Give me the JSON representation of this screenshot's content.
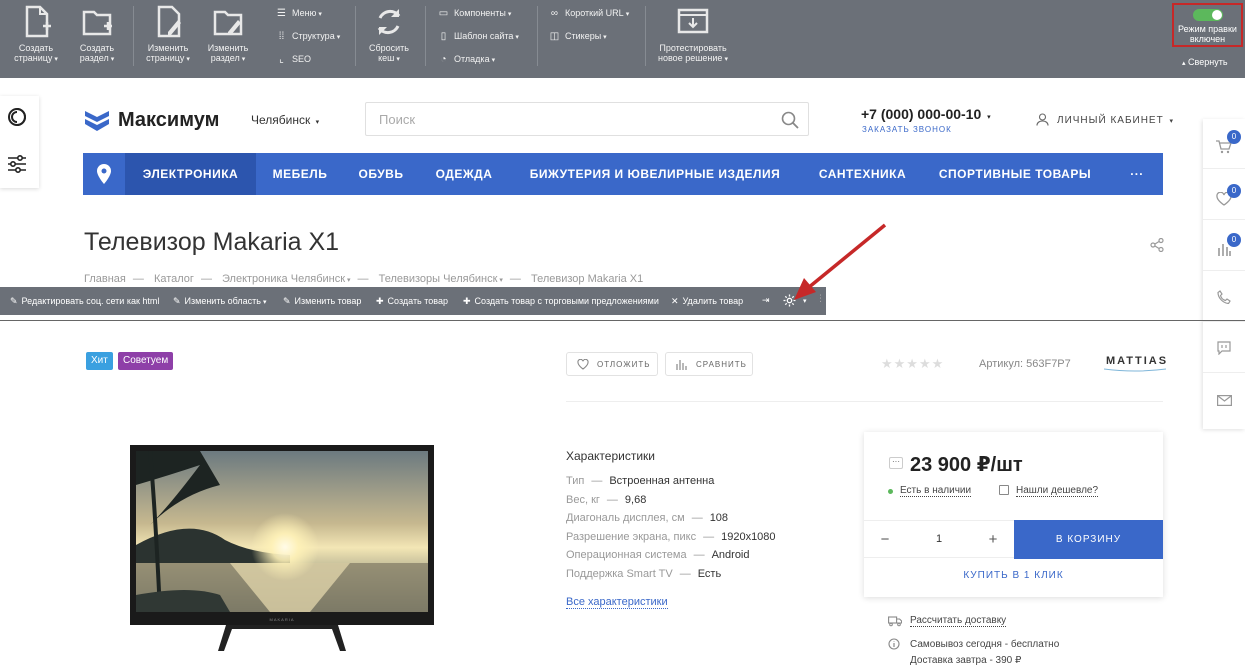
{
  "admin_bar": {
    "create_page": "Создать страницу",
    "create_section": "Создать раздел",
    "edit_page": "Изменить страницу",
    "edit_section": "Изменить раздел",
    "menu": "Меню",
    "structure": "Структура",
    "seo": "SEO",
    "reset_cache": "Сбросить кеш",
    "components": "Компоненты",
    "site_template": "Шаблон сайта",
    "debug": "Отладка",
    "short_url": "Короткий URL",
    "stickers": "Стикеры",
    "test_solution": "Протестировать новое решение",
    "edit_mode": "Режим правки включен",
    "collapse": "Свернуть"
  },
  "header": {
    "logo": "Максимум",
    "city": "Челябинск",
    "search_placeholder": "Поиск",
    "phone": "+7 (000) 000-00-10",
    "callback": "ЗАКАЗАТЬ ЗВОНОК",
    "cabinet": "ЛИЧНЫЙ КАБИНЕТ"
  },
  "nav": {
    "items": [
      "ЭЛЕКТРОНИКА",
      "МЕБЕЛЬ",
      "ОБУВЬ",
      "ОДЕЖДА",
      "БИЖУТЕРИЯ И ЮВЕЛИРНЫЕ ИЗДЕЛИЯ",
      "САНТЕХНИКА",
      "СПОРТИВНЫЕ ТОВАРЫ"
    ],
    "more": "···"
  },
  "right_panel": {
    "cart_count": "0",
    "favorites_count": "0",
    "compare_count": "0"
  },
  "product": {
    "title": "Телевизор Makaria X1",
    "breadcrumbs": [
      "Главная",
      "Каталог",
      "Электроника Челябинск",
      "Телевизоры Челябинск",
      "Телевизор Makaria X1"
    ],
    "badges": [
      {
        "label": "Хит",
        "color": "#3aa0e0"
      },
      {
        "label": "Советуем",
        "color": "#8e3fa8"
      }
    ],
    "defer": "ОТЛОЖИТЬ",
    "compare": "СРАВНИТЬ",
    "stars": "★★★★★",
    "article": "Артикул: 563F7P7",
    "brand": "MATTIAS",
    "tv_brand": "MAKARIA",
    "specs_title": "Характеристики",
    "specs": [
      {
        "name": "Тип",
        "value": "Встроенная антенна"
      },
      {
        "name": "Вес, кг",
        "value": "9,68"
      },
      {
        "name": "Диагональ дисплея, см",
        "value": "108"
      },
      {
        "name": "Разрешение экрана, пикс",
        "value": "1920x1080"
      },
      {
        "name": "Операционная система",
        "value": "Android"
      },
      {
        "name": "Поддержка Smart TV",
        "value": "Есть"
      }
    ],
    "all_specs": "Все характеристики",
    "price": "23 900 ₽/шт",
    "in_stock": "Есть в наличии",
    "cheaper": "Нашли дешевле?",
    "quantity": "1",
    "to_cart": "В КОРЗИНУ",
    "one_click": "КУПИТЬ В 1 КЛИК",
    "delivery_calc": "Рассчитать доставку",
    "pickup": "Самовывоз сегодня - бесплатно",
    "delivery_tomorrow": "Доставка завтра - 390 ₽"
  },
  "edit_bar": {
    "edit_social": "Редактировать соц. сети как html",
    "edit_area": "Изменить область",
    "edit_product": "Изменить товар",
    "create_product": "Создать товар",
    "create_with_offers": "Создать товар с торговыми предложениями",
    "delete_product": "Удалить товар"
  },
  "colors": {
    "accent": "#3a68c9",
    "admin_bg": "#6b7078",
    "arrow": "#c62828"
  }
}
